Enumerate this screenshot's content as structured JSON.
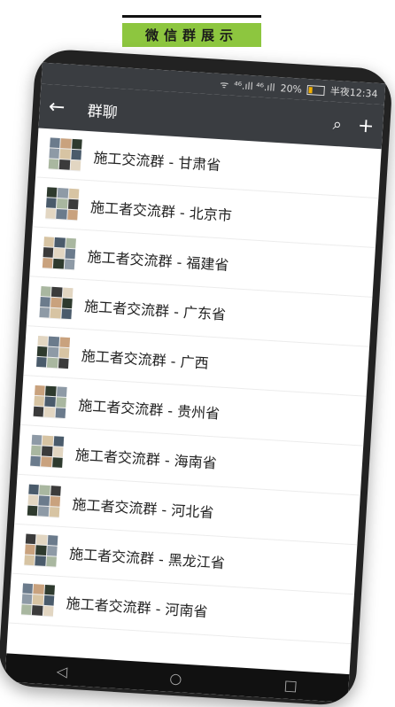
{
  "banner": {
    "title": "微信群展示"
  },
  "status_bar": {
    "signal_text": "⁴⁶.ıll ⁴⁶.ıll",
    "battery": "20%",
    "time": "半夜12:34"
  },
  "app_bar": {
    "title": "群聊"
  },
  "groups": [
    {
      "name": "施工交流群 - 甘肃省"
    },
    {
      "name": "施工者交流群 - 北京市"
    },
    {
      "name": "施工者交流群 - 福建省"
    },
    {
      "name": "施工者交流群 - 广东省"
    },
    {
      "name": "施工者交流群 - 广西"
    },
    {
      "name": "施工者交流群 - 贵州省"
    },
    {
      "name": "施工者交流群 - 海南省"
    },
    {
      "name": "施工者交流群 - 河北省"
    },
    {
      "name": "施工者交流群 - 黑龙江省"
    },
    {
      "name": "施工者交流群 - 河南省"
    }
  ],
  "avatar_palette": [
    "#6b7b8c",
    "#c9a27e",
    "#2e3a2e",
    "#8e9aa6",
    "#d7c4a3",
    "#4a5b6b",
    "#a9b7a0",
    "#3b3b3b",
    "#e2d6c2"
  ]
}
